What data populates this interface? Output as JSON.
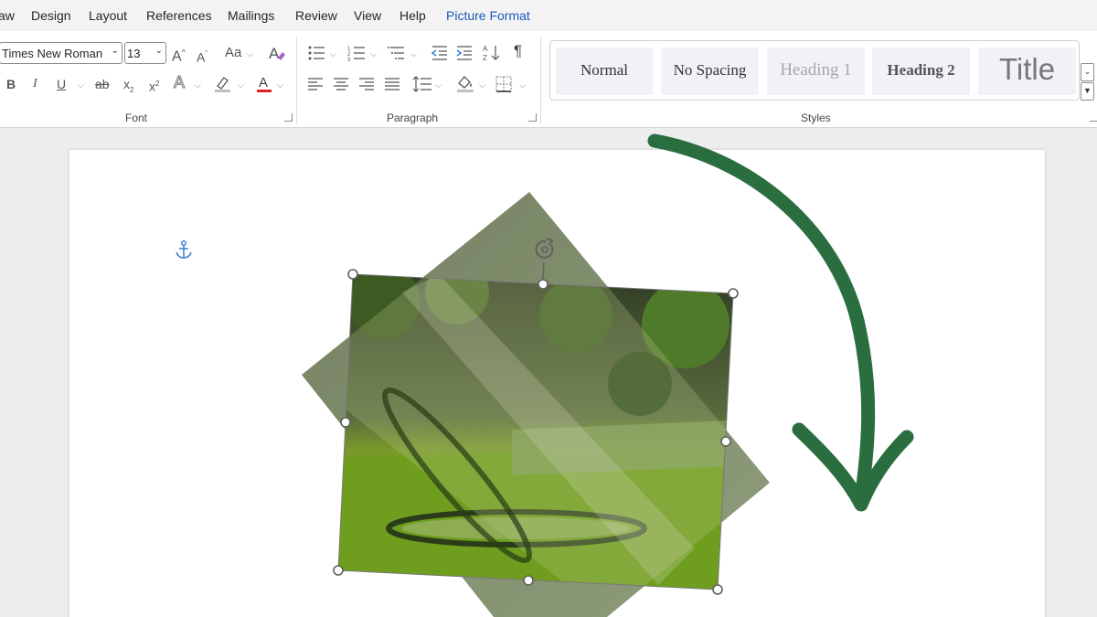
{
  "menu": {
    "tabs": [
      "aw",
      "Design",
      "Layout",
      "References",
      "Mailings",
      "Review",
      "View",
      "Help",
      "Picture Format"
    ]
  },
  "ribbon": {
    "font": {
      "name": "Times New Roman",
      "size": "13",
      "grow_label": "A",
      "shrink_label": "A",
      "case_label": "Aa",
      "bold": "B",
      "italic": "I",
      "underline": "U",
      "strike": "ab",
      "subscript": "x",
      "subscript_mark": "2",
      "superscript": "x",
      "superscript_mark": "2",
      "effects": "A",
      "font_color": "A",
      "group_label": "Font"
    },
    "paragraph": {
      "show_marks": "¶",
      "group_label": "Paragraph"
    },
    "styles": {
      "items": [
        "Normal",
        "No Spacing",
        "Heading 1",
        "Heading 2",
        "Title"
      ],
      "group_label": "Styles"
    }
  },
  "colors": {
    "accent": "#185abd",
    "font_color_bar": "#e0201c",
    "highlight_bar": "#bfbfbf",
    "arrow": "#2a6e3f",
    "selection_handle": "#606060"
  },
  "icons": [
    "clear-formatting-icon",
    "bullets-icon",
    "numbering-icon",
    "multilevel-list-icon",
    "decrease-indent-icon",
    "increase-indent-icon",
    "sort-icon",
    "align-left-icon",
    "center-icon",
    "align-right-icon",
    "justify-icon",
    "line-spacing-icon",
    "shading-icon",
    "borders-icon",
    "anchor-icon",
    "rotate-handle-icon",
    "rotation-arrow-icon"
  ]
}
